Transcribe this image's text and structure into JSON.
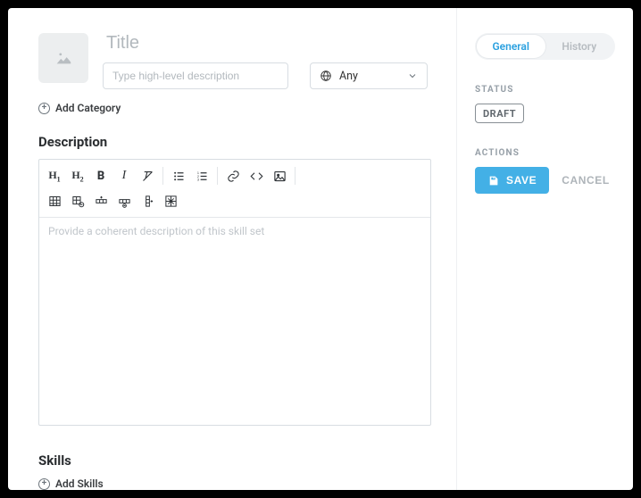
{
  "header": {
    "title_placeholder": "Title",
    "title_value": "",
    "desc_placeholder": "Type high-level description",
    "desc_value": "",
    "select": {
      "label": "Any"
    }
  },
  "links": {
    "add_category": "Add Category",
    "add_skills": "Add Skills"
  },
  "sections": {
    "description": "Description",
    "skills": "Skills"
  },
  "editor": {
    "placeholder": "Provide a coherent description of this skill set",
    "toolbar": {
      "h1": "H",
      "h1sub": "1",
      "h2": "H",
      "h2sub": "2"
    }
  },
  "sidebar": {
    "tabs": {
      "general": "General",
      "history": "History"
    },
    "status_label": "STATUS",
    "status_value": "DRAFT",
    "actions_label": "ACTIONS",
    "save": "SAVE",
    "cancel": "CANCEL"
  }
}
